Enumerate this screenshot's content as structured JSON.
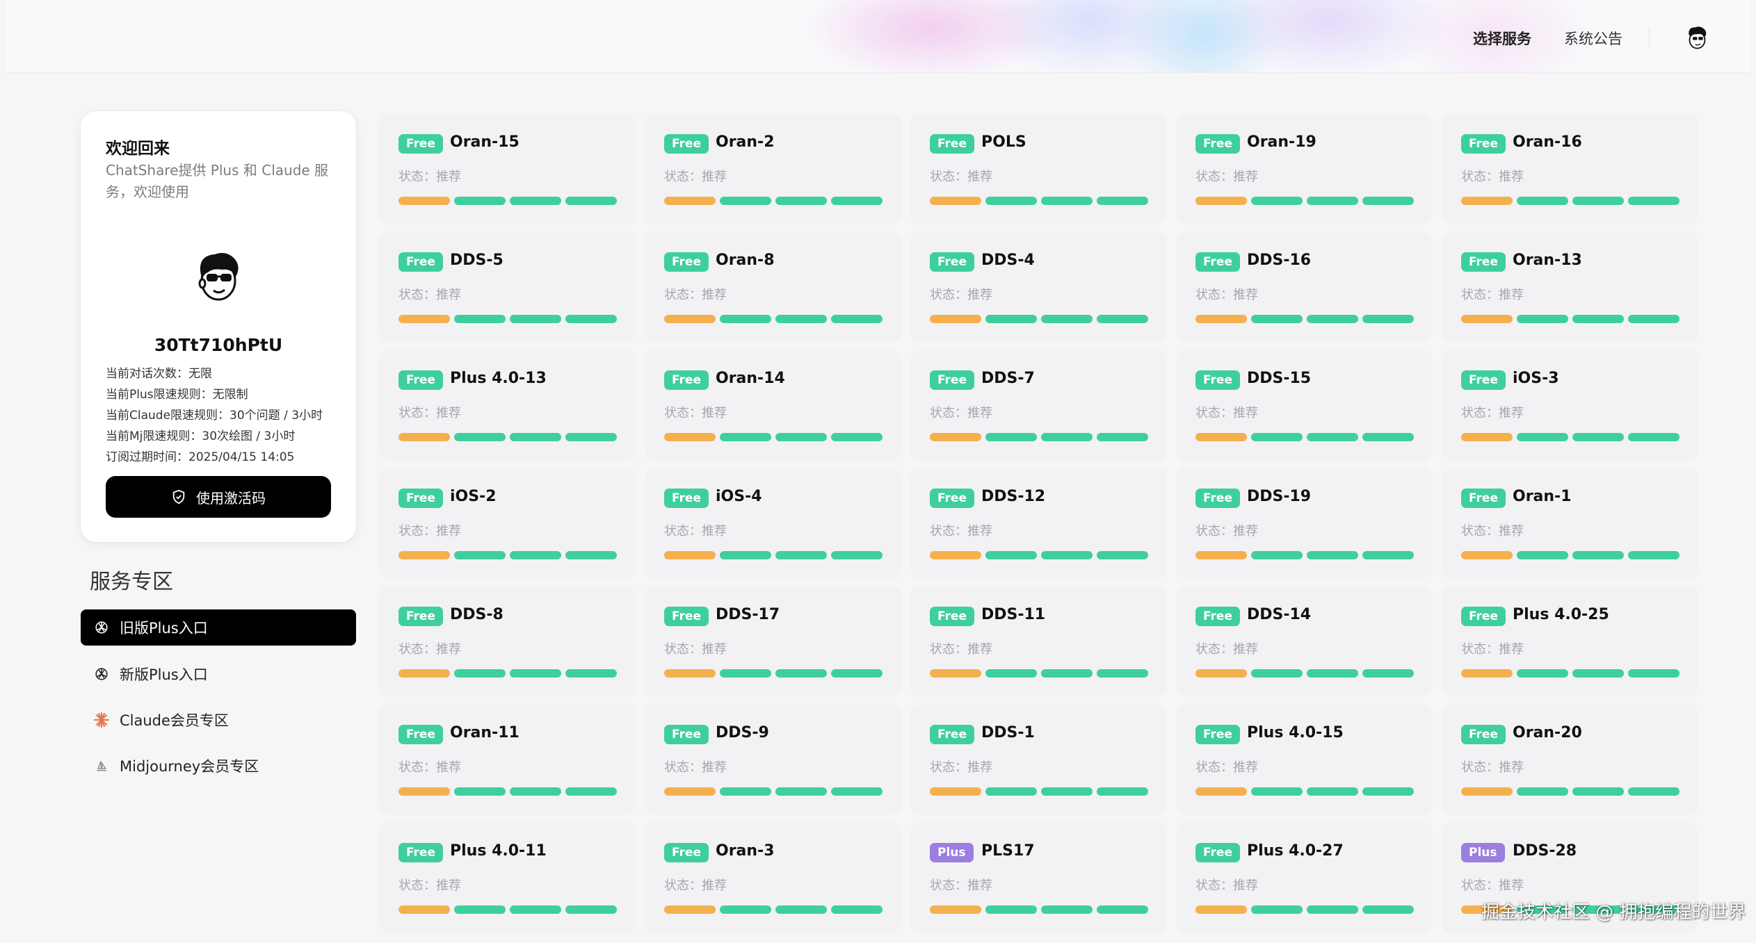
{
  "header": {
    "nav": [
      "选择服务",
      "系统公告"
    ],
    "avatar_icon": "cartoon-avatar-icon"
  },
  "profile": {
    "welcome": "欢迎回来",
    "subtitle": "ChatShare提供 Plus 和 Claude 服务，欢迎使用",
    "username": "30Tt710hPtU",
    "info": [
      "当前对话次数：无限",
      "当前Plus限速规则：无限制",
      "当前Claude限速规则：30个问题 / 3小时",
      "当前Mj限速规则：30次绘图 / 3小时",
      "订阅过期时间：2025/04/15 14:05"
    ],
    "activate_label": "使用激活码"
  },
  "services_section": {
    "title": "服务专区",
    "items": [
      {
        "label": "旧版Plus入口",
        "icon": "openai-icon",
        "active": true
      },
      {
        "label": "新版Plus入口",
        "icon": "openai-icon",
        "active": false
      },
      {
        "label": "Claude会员专区",
        "icon": "claude-icon",
        "active": false
      },
      {
        "label": "Midjourney会员专区",
        "icon": "midjourney-icon",
        "active": false
      }
    ]
  },
  "colors": {
    "free_badge": "#3fcf9e",
    "plus_badge": "#9b7ee0",
    "bar_orange": "#f5b04e",
    "bar_green": "#3fcf9e"
  },
  "cards": [
    {
      "badge": "Free",
      "name": "Oran-15",
      "status": "状态：推荐"
    },
    {
      "badge": "Free",
      "name": "Oran-2",
      "status": "状态：推荐"
    },
    {
      "badge": "Free",
      "name": "POLS",
      "status": "状态：推荐"
    },
    {
      "badge": "Free",
      "name": "Oran-19",
      "status": "状态：推荐"
    },
    {
      "badge": "Free",
      "name": "Oran-16",
      "status": "状态：推荐"
    },
    {
      "badge": "Free",
      "name": "DDS-5",
      "status": "状态：推荐"
    },
    {
      "badge": "Free",
      "name": "Oran-8",
      "status": "状态：推荐"
    },
    {
      "badge": "Free",
      "name": "DDS-4",
      "status": "状态：推荐"
    },
    {
      "badge": "Free",
      "name": "DDS-16",
      "status": "状态：推荐"
    },
    {
      "badge": "Free",
      "name": "Oran-13",
      "status": "状态：推荐"
    },
    {
      "badge": "Free",
      "name": "Plus 4.0-13",
      "status": "状态：推荐"
    },
    {
      "badge": "Free",
      "name": "Oran-14",
      "status": "状态：推荐"
    },
    {
      "badge": "Free",
      "name": "DDS-7",
      "status": "状态：推荐"
    },
    {
      "badge": "Free",
      "name": "DDS-15",
      "status": "状态：推荐"
    },
    {
      "badge": "Free",
      "name": "iOS-3",
      "status": "状态：推荐"
    },
    {
      "badge": "Free",
      "name": "iOS-2",
      "status": "状态：推荐"
    },
    {
      "badge": "Free",
      "name": "iOS-4",
      "status": "状态：推荐"
    },
    {
      "badge": "Free",
      "name": "DDS-12",
      "status": "状态：推荐"
    },
    {
      "badge": "Free",
      "name": "DDS-19",
      "status": "状态：推荐"
    },
    {
      "badge": "Free",
      "name": "Oran-1",
      "status": "状态：推荐"
    },
    {
      "badge": "Free",
      "name": "DDS-8",
      "status": "状态：推荐"
    },
    {
      "badge": "Free",
      "name": "DDS-17",
      "status": "状态：推荐"
    },
    {
      "badge": "Free",
      "name": "DDS-11",
      "status": "状态：推荐"
    },
    {
      "badge": "Free",
      "name": "DDS-14",
      "status": "状态：推荐"
    },
    {
      "badge": "Free",
      "name": "Plus 4.0-25",
      "status": "状态：推荐"
    },
    {
      "badge": "Free",
      "name": "Oran-11",
      "status": "状态：推荐"
    },
    {
      "badge": "Free",
      "name": "DDS-9",
      "status": "状态：推荐"
    },
    {
      "badge": "Free",
      "name": "DDS-1",
      "status": "状态：推荐"
    },
    {
      "badge": "Free",
      "name": "Plus 4.0-15",
      "status": "状态：推荐"
    },
    {
      "badge": "Free",
      "name": "Oran-20",
      "status": "状态：推荐"
    },
    {
      "badge": "Free",
      "name": "Plus 4.0-11",
      "status": "状态：推荐"
    },
    {
      "badge": "Free",
      "name": "Oran-3",
      "status": "状态：推荐"
    },
    {
      "badge": "Plus",
      "name": "PLS17",
      "status": "状态：推荐"
    },
    {
      "badge": "Free",
      "name": "Plus 4.0-27",
      "status": "状态：推荐"
    },
    {
      "badge": "Plus",
      "name": "DDS-28",
      "status": "状态：推荐"
    }
  ],
  "watermark": "掘金技术社区 @ 拥抱编程的世界"
}
